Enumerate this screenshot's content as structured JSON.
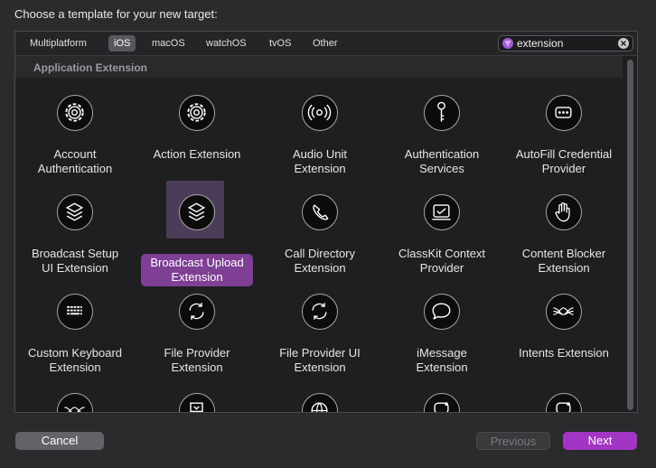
{
  "dialog": {
    "heading": "Choose a template for your new target:"
  },
  "tabs": [
    {
      "label": "Multiplatform",
      "selected": false
    },
    {
      "label": "iOS",
      "selected": true
    },
    {
      "label": "macOS",
      "selected": false
    },
    {
      "label": "watchOS",
      "selected": false
    },
    {
      "label": "tvOS",
      "selected": false
    },
    {
      "label": "Other",
      "selected": false
    }
  ],
  "search": {
    "value": "extension",
    "placeholder": ""
  },
  "section": {
    "title": "Application Extension"
  },
  "templates": [
    {
      "label": "Account\nAuthentication",
      "icon": "gear-icon"
    },
    {
      "label": "Action Extension",
      "icon": "gear-icon"
    },
    {
      "label": "Audio Unit\nExtension",
      "icon": "audio-wave-icon"
    },
    {
      "label": "Authentication\nServices",
      "icon": "key-icon"
    },
    {
      "label": "AutoFill Credential\nProvider",
      "icon": "password-dots-icon"
    },
    {
      "label": "Broadcast Setup\nUI Extension",
      "icon": "layers-icon"
    },
    {
      "label": "Broadcast Upload\nExtension",
      "icon": "layers-icon",
      "selected": true
    },
    {
      "label": "Call Directory\nExtension",
      "icon": "phone-icon"
    },
    {
      "label": "ClassKit Context\nProvider",
      "icon": "classkit-icon"
    },
    {
      "label": "Content Blocker\nExtension",
      "icon": "hand-icon"
    },
    {
      "label": "Custom Keyboard\nExtension",
      "icon": "keyboard-icon"
    },
    {
      "label": "File Provider\nExtension",
      "icon": "sync-icon"
    },
    {
      "label": "File Provider UI\nExtension",
      "icon": "sync-icon"
    },
    {
      "label": "iMessage\nExtension",
      "icon": "message-bubble-icon"
    },
    {
      "label": "Intents Extension",
      "icon": "waves-icon"
    },
    {
      "label": "",
      "icon": "waves-icon"
    },
    {
      "label": "",
      "icon": "archive-icon"
    },
    {
      "label": "",
      "icon": "globe-icon"
    },
    {
      "label": "",
      "icon": "message-bubble-icon"
    },
    {
      "label": "",
      "icon": "message-bubble-icon"
    }
  ],
  "buttons": {
    "cancel": "Cancel",
    "previous": "Previous",
    "next": "Next"
  },
  "colors": {
    "accent": "#a335c4",
    "selection": "#7e3f95"
  }
}
